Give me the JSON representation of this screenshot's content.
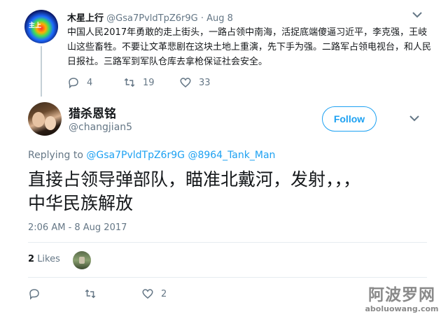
{
  "parent_tweet": {
    "avatar_text": "主上",
    "display_name": "木星上行",
    "handle": "@Gsa7PvldTpZ6r9G",
    "separator": "·",
    "date": "Aug 8",
    "text": "中国人民2017年勇敢的走上街头，一路占领中南海，活捉底端傻逼习近平，李克强，王岐山这些畜牲。不要让文革悲剧在这块土地上重演，先下手为强。二路军占领电视台，和人民日报社。三路军到军队仓库去拿枪保证社会安全。",
    "reply_count": "4",
    "retweet_count": "19",
    "like_count": "33",
    "icons": {
      "reply": "reply-icon",
      "retweet": "retweet-icon",
      "like": "heart-icon",
      "more": "chevron-down-icon"
    }
  },
  "main_tweet": {
    "display_name": "猎杀恩铭",
    "handle": "@changjian5",
    "follow_label": "Follow",
    "replying_prefix": "Replying to",
    "replying_to": [
      "@Gsa7PvldTpZ6r9G",
      "@8964_Tank_Man"
    ],
    "text_line1": "直接占领导弹部队，瞄准北戴河，发射，，，",
    "text_line2": "中华民族解放",
    "timestamp": "2:06 AM - 8 Aug 2017",
    "likes_count": "2",
    "likes_label": "Likes",
    "action_like_count": "2",
    "icons": {
      "reply": "reply-icon",
      "retweet": "retweet-icon",
      "like": "heart-icon",
      "more": "chevron-down-icon"
    }
  },
  "watermark": {
    "site_name": "阿波罗网",
    "site_url": "aboluowang.com"
  },
  "colors": {
    "accent": "#1da1f2",
    "secondary_text": "#657786",
    "primary_text": "#14171a",
    "divider": "#e6ecf0"
  }
}
